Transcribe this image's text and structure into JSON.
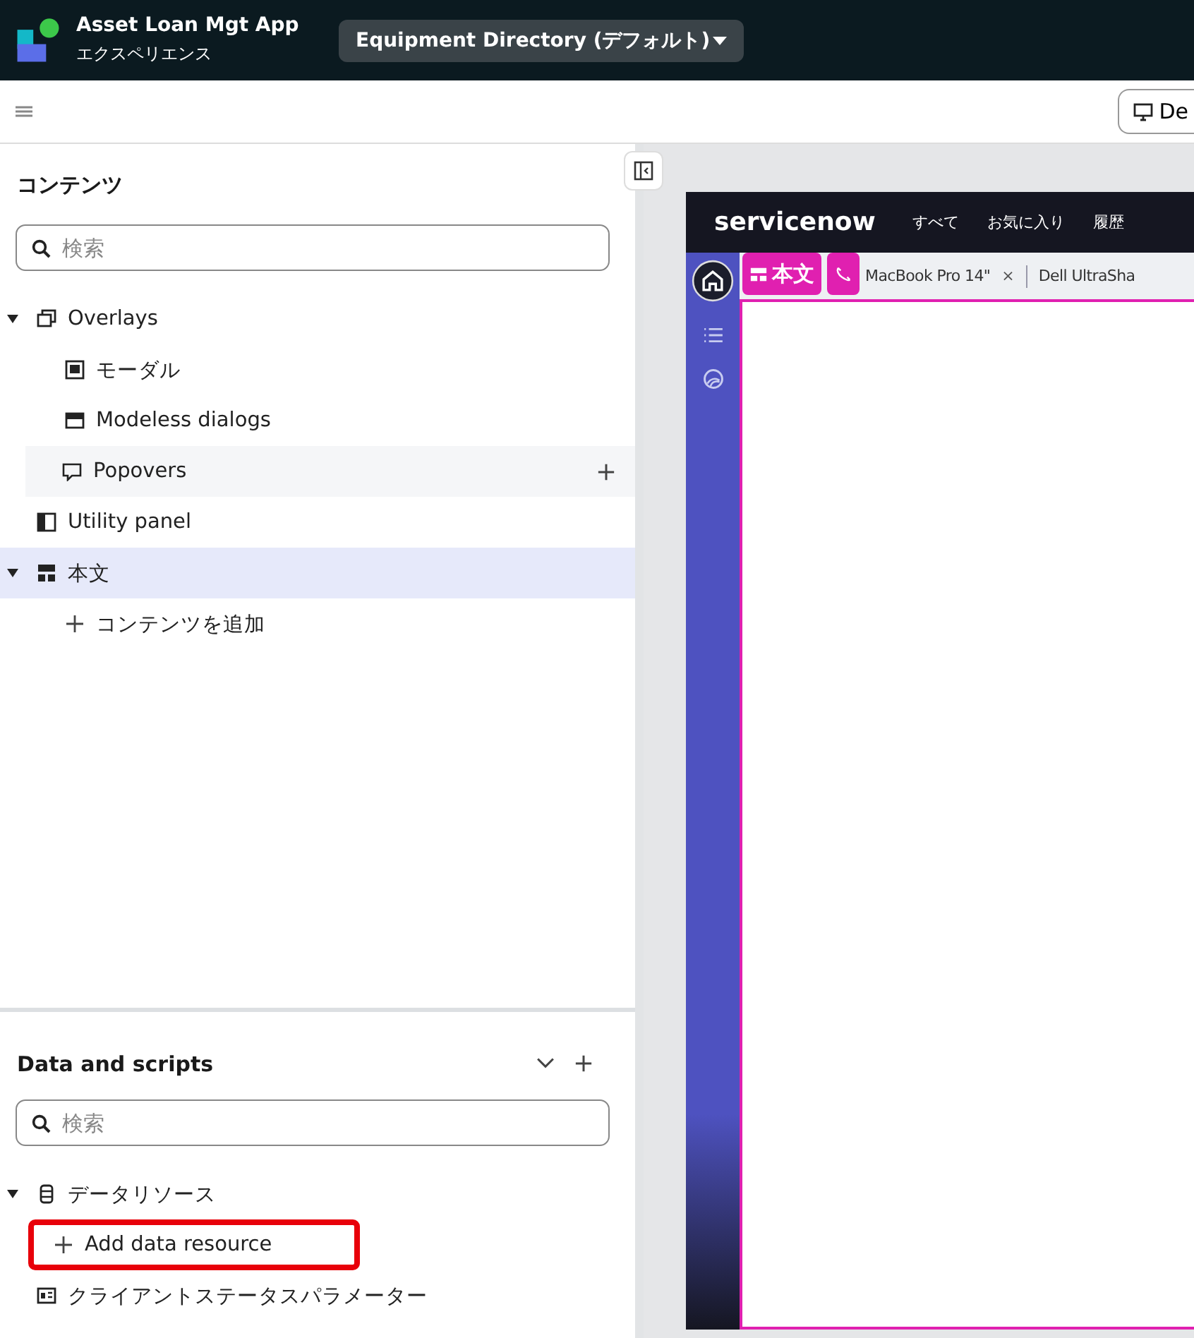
{
  "header": {
    "app_title": "Asset Loan Mgt App",
    "app_subtitle": "エクスペリエンス",
    "experience_select": "Equipment Directory (デフォルト)"
  },
  "toolbar": {
    "device_button": "De"
  },
  "contents_panel": {
    "title": "コンテンツ",
    "search": {
      "placeholder": "検索"
    },
    "tree": [
      {
        "kind": "overlays",
        "label": "Overlays",
        "expanded": true,
        "selected": false,
        "highlighted": false,
        "children": [
          {
            "kind": "modal",
            "label": "モーダル",
            "selected": false,
            "highlighted": false
          },
          {
            "kind": "modeless",
            "label": "Modeless dialogs",
            "selected": false,
            "highlighted": false
          },
          {
            "kind": "popover",
            "label": "Popovers",
            "selected": false,
            "highlighted": true
          }
        ]
      },
      {
        "kind": "utility",
        "label": "Utility panel",
        "selected": false,
        "highlighted": false
      },
      {
        "kind": "body",
        "label": "本文",
        "expanded": true,
        "selected": true,
        "highlighted": false,
        "children": [
          {
            "kind": "add",
            "label": "コンテンツを追加",
            "selected": false,
            "highlighted": false
          }
        ]
      }
    ]
  },
  "data_panel": {
    "title": "Data and scripts",
    "search": {
      "placeholder": "検索"
    },
    "tree": [
      {
        "kind": "datasource",
        "label": "データリソース",
        "expanded": true,
        "selected": false,
        "highlighted": false,
        "children": [
          {
            "kind": "add",
            "label": "Add data resource",
            "selected": false,
            "highlighted": false,
            "annotated": true
          }
        ]
      },
      {
        "kind": "params",
        "label": "クライアントステータスパラメーター",
        "selected": false,
        "highlighted": false
      }
    ]
  },
  "preview": {
    "logo": "servicenow",
    "nav": [
      "すべて",
      "お気に入り",
      "履歴"
    ],
    "tabs": [
      {
        "kind": "pinned",
        "label": "本文"
      },
      {
        "kind": "pinned-icon"
      },
      {
        "kind": "record",
        "label": "MacBook Pro 14\"",
        "close": "×"
      },
      {
        "kind": "record",
        "label": "Dell UltraSha"
      }
    ]
  }
}
